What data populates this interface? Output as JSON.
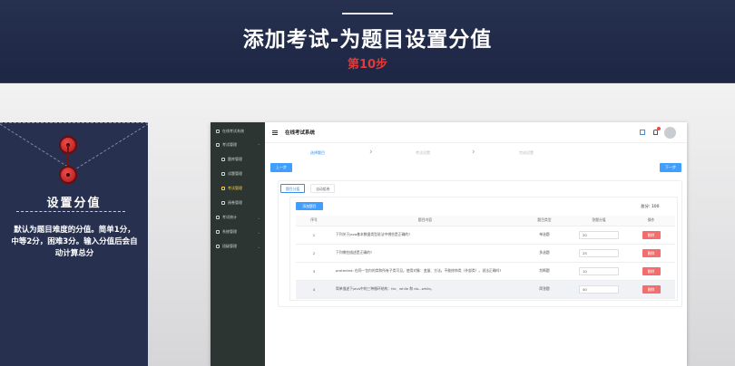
{
  "banner": {
    "title": "添加考试-为题目设置分值",
    "step": "第10步"
  },
  "card": {
    "heading": "设置分值",
    "body": "默认为题目难度的分值。简单1分，中等2分，困难3分。输入分值后会自动计算总分"
  },
  "app": {
    "system_title": "在线考试系统",
    "sidebar": [
      {
        "label": "在线考试系统",
        "sub": false,
        "active": false
      },
      {
        "label": "考试管理",
        "sub": false,
        "active": false
      },
      {
        "label": "题库管理",
        "sub": true,
        "active": false
      },
      {
        "label": "试题管理",
        "sub": true,
        "active": false
      },
      {
        "label": "考试管理",
        "sub": true,
        "active": true
      },
      {
        "label": "阅卷管理",
        "sub": true,
        "active": false
      },
      {
        "label": "考试统计",
        "sub": false,
        "active": false
      },
      {
        "label": "系统管理",
        "sub": false,
        "active": false
      },
      {
        "label": "班级管理",
        "sub": false,
        "active": false
      }
    ],
    "steps": [
      "选择题目",
      "考试设置",
      "完成设置"
    ],
    "prev_label": "上一步",
    "next_label": "下一步",
    "tabs": [
      "题目分值",
      "自动组卷"
    ],
    "add_label": "添加题目",
    "total": "总分: 100",
    "table": {
      "headers": [
        "序号",
        "题目内容",
        "题目类型",
        "答题分值",
        "操作"
      ],
      "rows": [
        {
          "no": "1",
          "content": "下列关于java基本数据类型说法中哪些是正确的?",
          "type": "单选题",
          "score": "20",
          "action": "删除"
        },
        {
          "no": "2",
          "content": "下列哪些描述是正确的?",
          "type": "多选题",
          "score": "25",
          "action": "删除"
        },
        {
          "no": "3",
          "content": "protected: 在同一包内的类和所有子类可见。使用对象：变量、方法。不能修饰类（外部类）。说法正确吗?",
          "type": "判断题",
          "score": "10",
          "action": "删除"
        },
        {
          "no": "4",
          "content": "简单描述下java中的三种循环结构：for、while 和 do...while。",
          "type": "简答题",
          "score": "40",
          "action": "删除"
        }
      ]
    }
  }
}
